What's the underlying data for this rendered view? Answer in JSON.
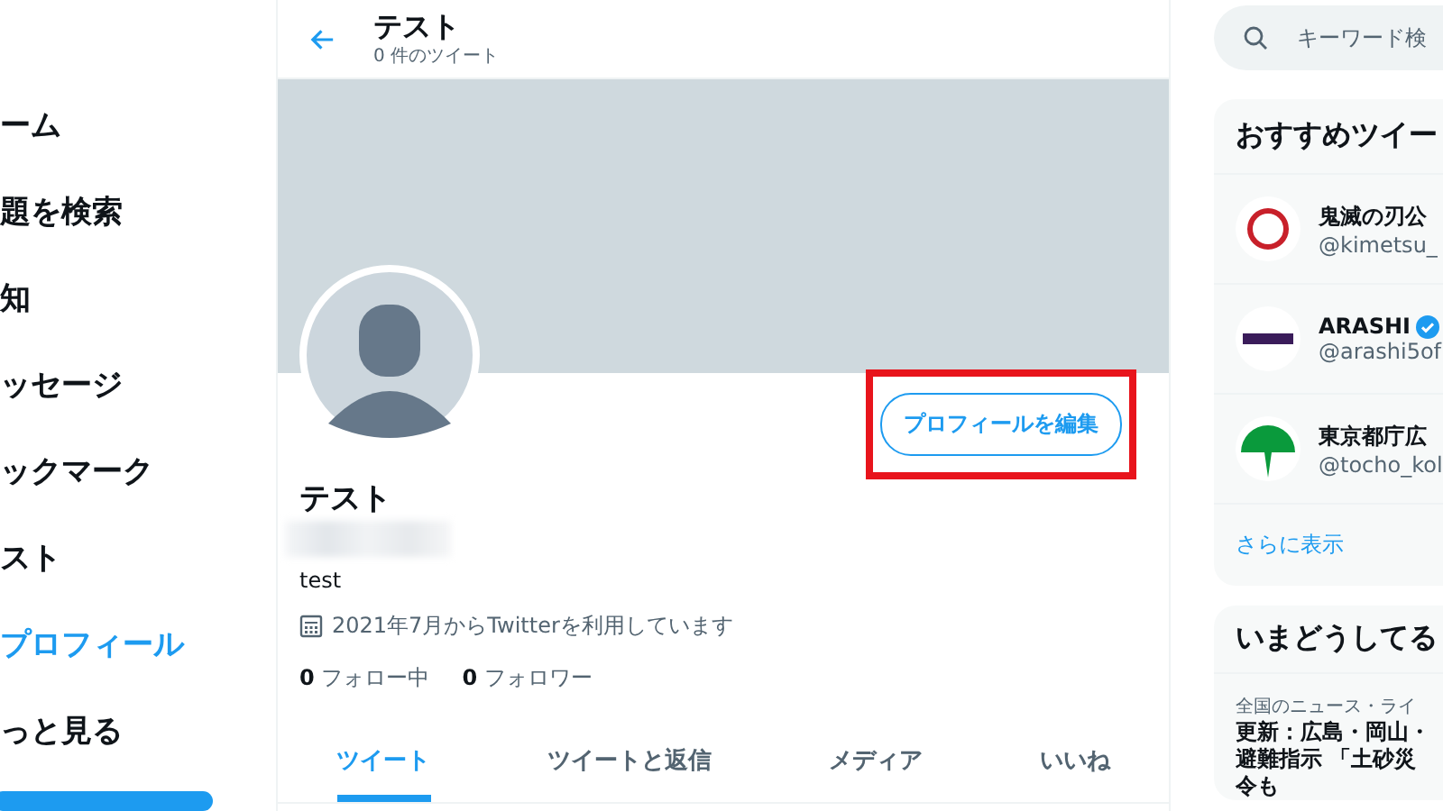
{
  "sidebar": {
    "items": [
      {
        "label": "ーム",
        "selected": false
      },
      {
        "label": "題を検索",
        "selected": false
      },
      {
        "label": "知",
        "selected": false
      },
      {
        "label": "ッセージ",
        "selected": false
      },
      {
        "label": "ックマーク",
        "selected": false
      },
      {
        "label": "スト",
        "selected": false
      },
      {
        "label": "プロフィール",
        "selected": true
      },
      {
        "label": "っと見る",
        "selected": false
      }
    ]
  },
  "header": {
    "title": "テスト",
    "subtitle": "0 件のツイート"
  },
  "profile": {
    "name": "テスト",
    "bio": "test",
    "joined": "2021年7月からTwitterを利用しています",
    "edit_button": "プロフィールを編集",
    "stats": [
      {
        "count": "0",
        "label": "フォロー中"
      },
      {
        "count": "0",
        "label": "フォロワー"
      }
    ]
  },
  "tabs": [
    {
      "label": "ツイート",
      "selected": true
    },
    {
      "label": "ツイートと返信",
      "selected": false
    },
    {
      "label": "メディア",
      "selected": false
    },
    {
      "label": "いいね",
      "selected": false
    }
  ],
  "search": {
    "placeholder": "キーワード検"
  },
  "recommended": {
    "title": "おすすめツイー",
    "accounts": [
      {
        "name": "鬼滅の刃公",
        "handle": "@kimetsu_",
        "verified": false,
        "kind": "ring"
      },
      {
        "name": "ARASHI",
        "handle": "@arashi5of",
        "verified": true,
        "kind": "bar"
      },
      {
        "name": "東京都庁広",
        "handle": "@tocho_kol",
        "verified": false,
        "kind": "leaf"
      }
    ],
    "more": "さらに表示"
  },
  "trends": {
    "title": "いまどうしてる",
    "category": "全国のニュース・ライ",
    "lines": [
      "更新：広島・岡山・",
      "避難指示 「土砂災",
      "令も"
    ]
  }
}
